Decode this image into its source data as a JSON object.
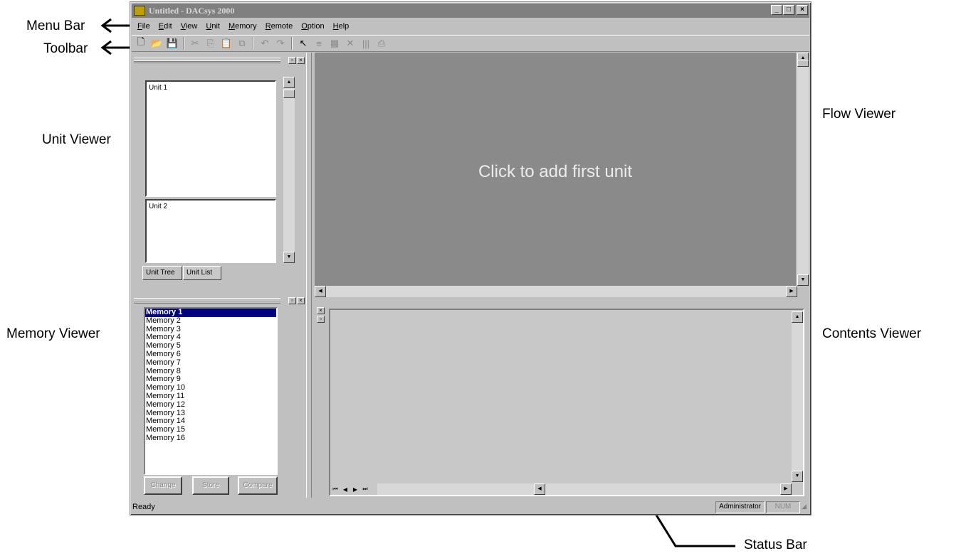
{
  "callouts": {
    "menu_bar": "Menu Bar",
    "toolbar": "Toolbar",
    "unit_viewer": "Unit Viewer",
    "memory_viewer": "Memory Viewer",
    "flow_viewer": "Flow Viewer",
    "contents_viewer": "Contents Viewer",
    "status_bar": "Status Bar"
  },
  "window": {
    "title": "Untitled - DACsys 2000",
    "buttons": [
      "_",
      "□",
      "×"
    ]
  },
  "menu": [
    "File",
    "Edit",
    "View",
    "Unit",
    "Memory",
    "Remote",
    "Option",
    "Help"
  ],
  "toolbar": {
    "icons": [
      "new-file-icon",
      "open-folder-icon",
      "save-icon",
      "cut-icon",
      "copy-icon",
      "paste-icon",
      "link-icon",
      "undo-icon",
      "redo-icon",
      "pointer-icon",
      "align-icon",
      "grid-icon",
      "delete-icon",
      "columns-icon",
      "print-icon"
    ],
    "glyphs": [
      "🗋",
      "📂",
      "💾",
      "✂",
      "⎘",
      "📋",
      "⧉",
      "↶",
      "↷",
      "↖",
      "≡",
      "▦",
      "✕",
      "|||",
      "⎙"
    ]
  },
  "unit_viewer": {
    "units": [
      "Unit 1",
      "Unit 2"
    ],
    "tabs": [
      "Unit Tree",
      "Unit List"
    ]
  },
  "memory_viewer": {
    "items": [
      "Memory 1",
      "Memory 2",
      "Memory 3",
      "Memory 4",
      "Memory 5",
      "Memory 6",
      "Memory 7",
      "Memory 8",
      "Memory 9",
      "Memory 10",
      "Memory 11",
      "Memory 12",
      "Memory 13",
      "Memory 14",
      "Memory 15",
      "Memory 16"
    ],
    "selected_index": 0,
    "buttons": [
      "Change",
      "Store",
      "Compare"
    ]
  },
  "flow_viewer": {
    "message": "Click to add first unit"
  },
  "contents_viewer": {
    "nav": [
      "⏮",
      "◀",
      "▶",
      "⏭"
    ]
  },
  "status_bar": {
    "text": "Ready",
    "user": "Administrator",
    "indicator": "NUM"
  }
}
